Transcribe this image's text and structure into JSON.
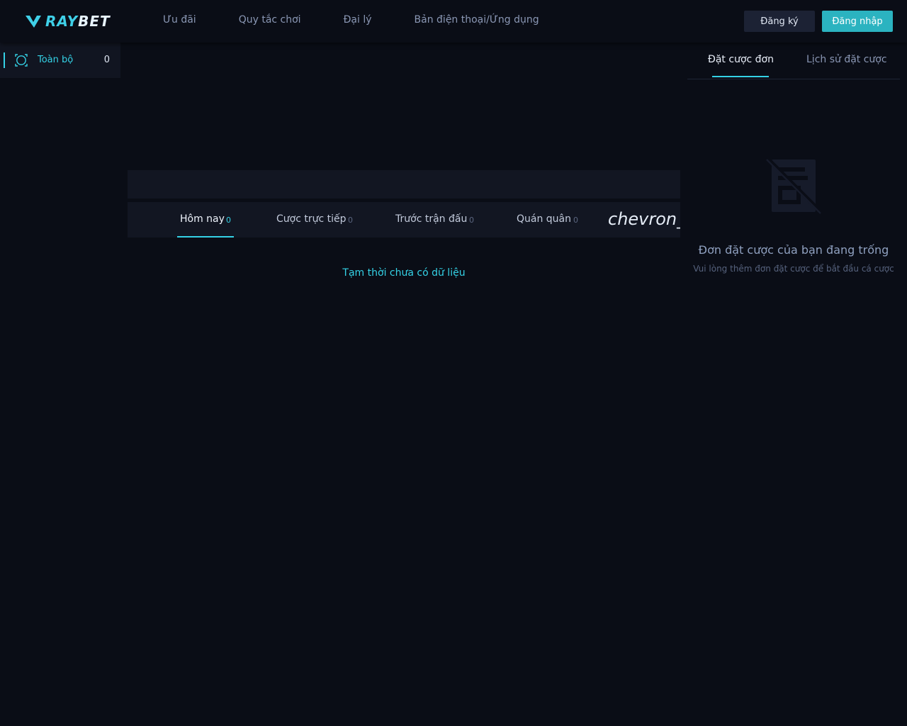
{
  "brand": {
    "logo_text_ray": "RAY",
    "logo_text_bet": "BET"
  },
  "nav": {
    "items": [
      "Ưu đãi",
      "Quy tắc chơi",
      "Đại lý",
      "Bản điện thoại/Ứng dụng"
    ]
  },
  "auth": {
    "register_label": "Đăng ký",
    "login_label": "Đăng nhập"
  },
  "sidebar": {
    "items": [
      {
        "label": "Toàn bộ",
        "count": "0",
        "icon": "soccer-ball-icon",
        "active": true
      }
    ]
  },
  "main": {
    "tabs": [
      {
        "label": "Hôm nay",
        "count": "0",
        "active": true
      },
      {
        "label": "Cược trực tiếp",
        "count": "0",
        "active": false
      },
      {
        "label": "Trước trận đấu",
        "count": "0",
        "active": false
      },
      {
        "label": "Quán quân",
        "count": "0",
        "active": false
      }
    ],
    "overflow_text": "chevron_",
    "empty_text": "Tạm thời chưa có dữ liệu"
  },
  "betslip": {
    "tabs": [
      {
        "label": "Đặt cược đơn",
        "active": true
      },
      {
        "label": "Lịch sử đặt cược",
        "active": false
      }
    ],
    "empty_title": "Đơn đặt cược của bạn đang trống",
    "empty_subtitle": "Vui lòng thêm đơn đặt cược để bắt đầu cá cược",
    "empty_icon": "empty-betslip-icon"
  },
  "colors": {
    "accent": "#34d2e6",
    "background": "#0a0d16",
    "panel": "#121622",
    "login_button": "#2bb3c0"
  }
}
